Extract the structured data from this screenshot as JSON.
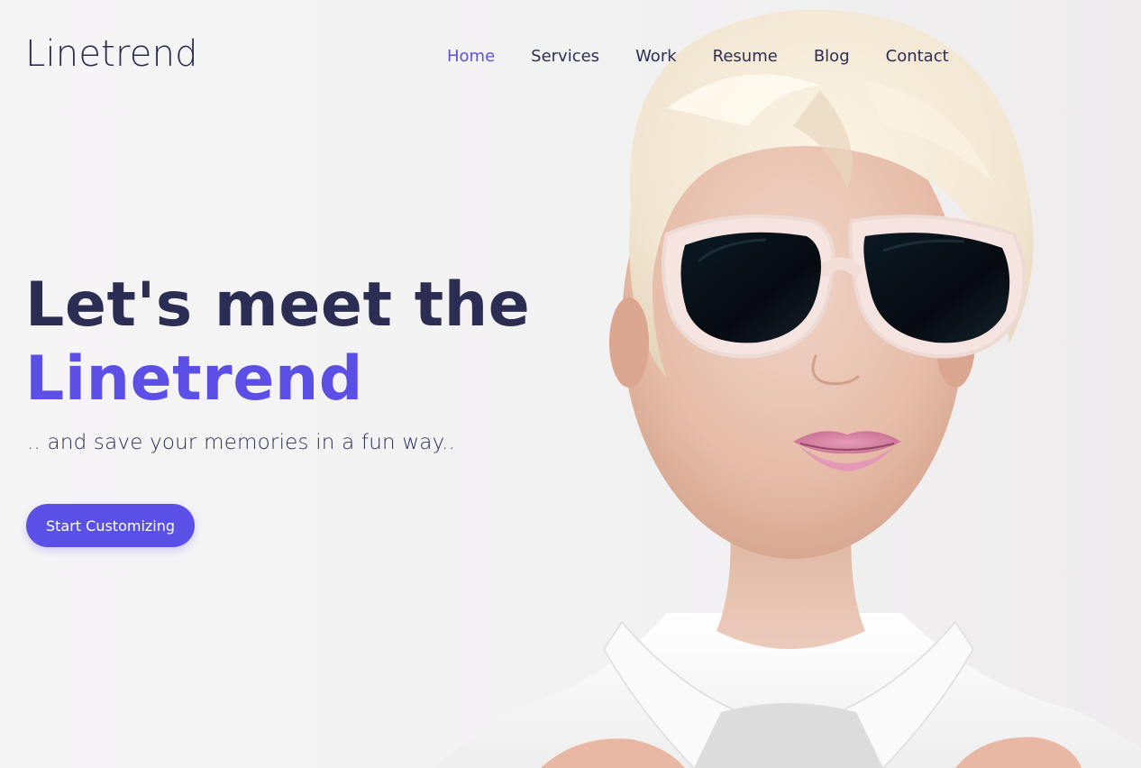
{
  "brand": {
    "name": "Linetrend"
  },
  "nav": {
    "items": [
      {
        "label": "Home",
        "active": true
      },
      {
        "label": "Services",
        "active": false
      },
      {
        "label": "Work",
        "active": false
      },
      {
        "label": "Resume",
        "active": false
      },
      {
        "label": "Blog",
        "active": false
      },
      {
        "label": "Contact",
        "active": false
      }
    ]
  },
  "hero": {
    "title_line1": "Let's meet the",
    "title_line2": "Linetrend",
    "subtitle": ".. and save your memories in a fun way..",
    "cta_label": "Start Customizing"
  },
  "colors": {
    "text_dark": "#2c2d52",
    "accent": "#5b4fe6",
    "button": "#5a50e8",
    "background": "#f3f2f3"
  },
  "icons": {
    "hero_image": "portrait-photo-woman-sunglasses"
  }
}
